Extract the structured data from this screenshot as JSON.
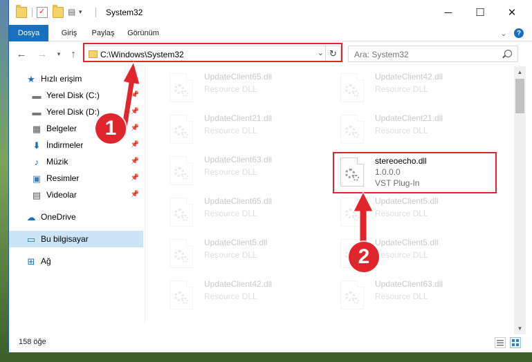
{
  "window": {
    "title": "System32",
    "accent": "#1a6fc1",
    "annotation_color": "#e0262c"
  },
  "ribbon": {
    "tabs": [
      "Dosya",
      "Giriş",
      "Paylaş",
      "Görünüm"
    ]
  },
  "address": {
    "path": "C:\\Windows\\System32",
    "search_placeholder": "Ara: System32"
  },
  "sidebar": {
    "items": [
      {
        "label": "Hızlı erişim",
        "icon": "star-icon",
        "pinned": false
      },
      {
        "label": "Yerel Disk (C:)",
        "icon": "drive-icon",
        "pinned": true
      },
      {
        "label": "Yerel Disk (D:)",
        "icon": "drive-icon",
        "pinned": true
      },
      {
        "label": "Belgeler",
        "icon": "documents-icon",
        "pinned": true
      },
      {
        "label": "İndirmeler",
        "icon": "download-icon",
        "pinned": true
      },
      {
        "label": "Müzik",
        "icon": "music-icon",
        "pinned": true
      },
      {
        "label": "Resimler",
        "icon": "pictures-icon",
        "pinned": true
      },
      {
        "label": "Videolar",
        "icon": "video-icon",
        "pinned": true
      },
      {
        "label": "OneDrive",
        "icon": "cloud-icon",
        "pinned": false
      },
      {
        "label": "Bu bilgisayar",
        "icon": "computer-icon",
        "pinned": false,
        "selected": true
      },
      {
        "label": "Ağ",
        "icon": "network-icon",
        "pinned": false
      }
    ]
  },
  "files": {
    "left": [
      {
        "name": "UpdateClient65.dll",
        "type": "Resource DLL"
      },
      {
        "name": "UpdateClient21.dll",
        "type": "Resource DLL"
      },
      {
        "name": "UpdateClient63.dll",
        "type": "Resource DLL"
      },
      {
        "name": "UpdateClient65.dll",
        "type": "Resource DLL"
      },
      {
        "name": "UpdateClient5.dll",
        "type": "Resource DLL"
      },
      {
        "name": "UpdateClient42.dll",
        "type": "Resource DLL"
      }
    ],
    "right": [
      {
        "name": "UpdateClient42.dll",
        "type": "Resource DLL"
      },
      {
        "name": "UpdateClient21.dll",
        "type": "Resource DLL"
      },
      {
        "name": "stereoecho.dll",
        "version": "1.0.0.0",
        "type": "VST Plug-In",
        "highlighted": true
      },
      {
        "name": "UpdateClient5.dll",
        "type": "Resource DLL"
      },
      {
        "name": "UpdateClient5.dll",
        "type": "Resource DLL"
      },
      {
        "name": "UpdateClient63.dll",
        "type": "Resource DLL"
      }
    ]
  },
  "status": {
    "item_count": "158 öğe"
  },
  "callouts": [
    "1",
    "2"
  ]
}
